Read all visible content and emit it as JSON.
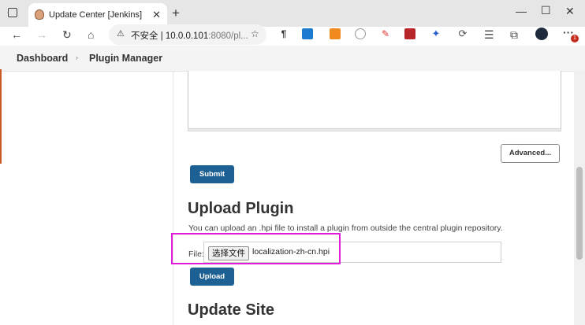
{
  "browser": {
    "tab_title": "Update Center [Jenkins]",
    "security_label": "不安全",
    "url_host": "10.0.0.101",
    "url_rest": ":8080/pl...",
    "notification_badge": "1"
  },
  "breadcrumb": {
    "items": [
      "Dashboard",
      "Plugin Manager"
    ]
  },
  "main": {
    "advanced_label": "Advanced...",
    "submit_label": "Submit",
    "upload_heading": "Upload Plugin",
    "upload_description": "You can upload an .hpi file to install a plugin from outside the central plugin repository.",
    "file_label": "File:",
    "choose_file_label": "选择文件",
    "file_name": "localization-zh-cn.hpi",
    "upload_label": "Upload",
    "update_site_heading": "Update Site"
  },
  "colors": {
    "primary_button": "#1d6094",
    "highlight_box": "#e11bd7"
  }
}
